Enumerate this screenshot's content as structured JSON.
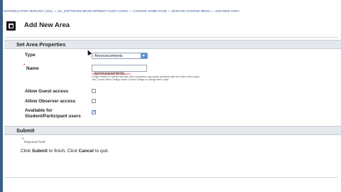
{
  "breadcrumb": [
    "Introductory Biology (101)",
    "UX_Software development fuzzy logic",
    "Course home page",
    "Manage Course Menu",
    "Add New Area"
  ],
  "page": {
    "title": "Add New Area"
  },
  "section_properties": {
    "title": "Set Area Properties",
    "type_label": "Type",
    "type_value": "Announcements",
    "name_label": "Name",
    "name_value": "Announcements",
    "name_hint_red": "Suggested maximum 15 characters.",
    "name_hint_gray_1": "Longer names or names that use wide characters may cause problems with the button Menu style.",
    "name_hint_gray_2": "Use Course Menu Design under Course Design to change Menu style.",
    "guest_label": "Allow Guest access",
    "guest_checked": false,
    "observer_label": "Allow Observer access",
    "observer_checked": false,
    "available_label_1": "Available for",
    "available_label_2": "Student/Participant users",
    "available_checked": true
  },
  "section_submit": {
    "title": "Submit",
    "required_note": "Required Field",
    "click_1": "Click ",
    "submit_word": "Submit",
    "click_2": " to finish. Click ",
    "cancel_word": "Cancel",
    "click_3": " to quit."
  }
}
